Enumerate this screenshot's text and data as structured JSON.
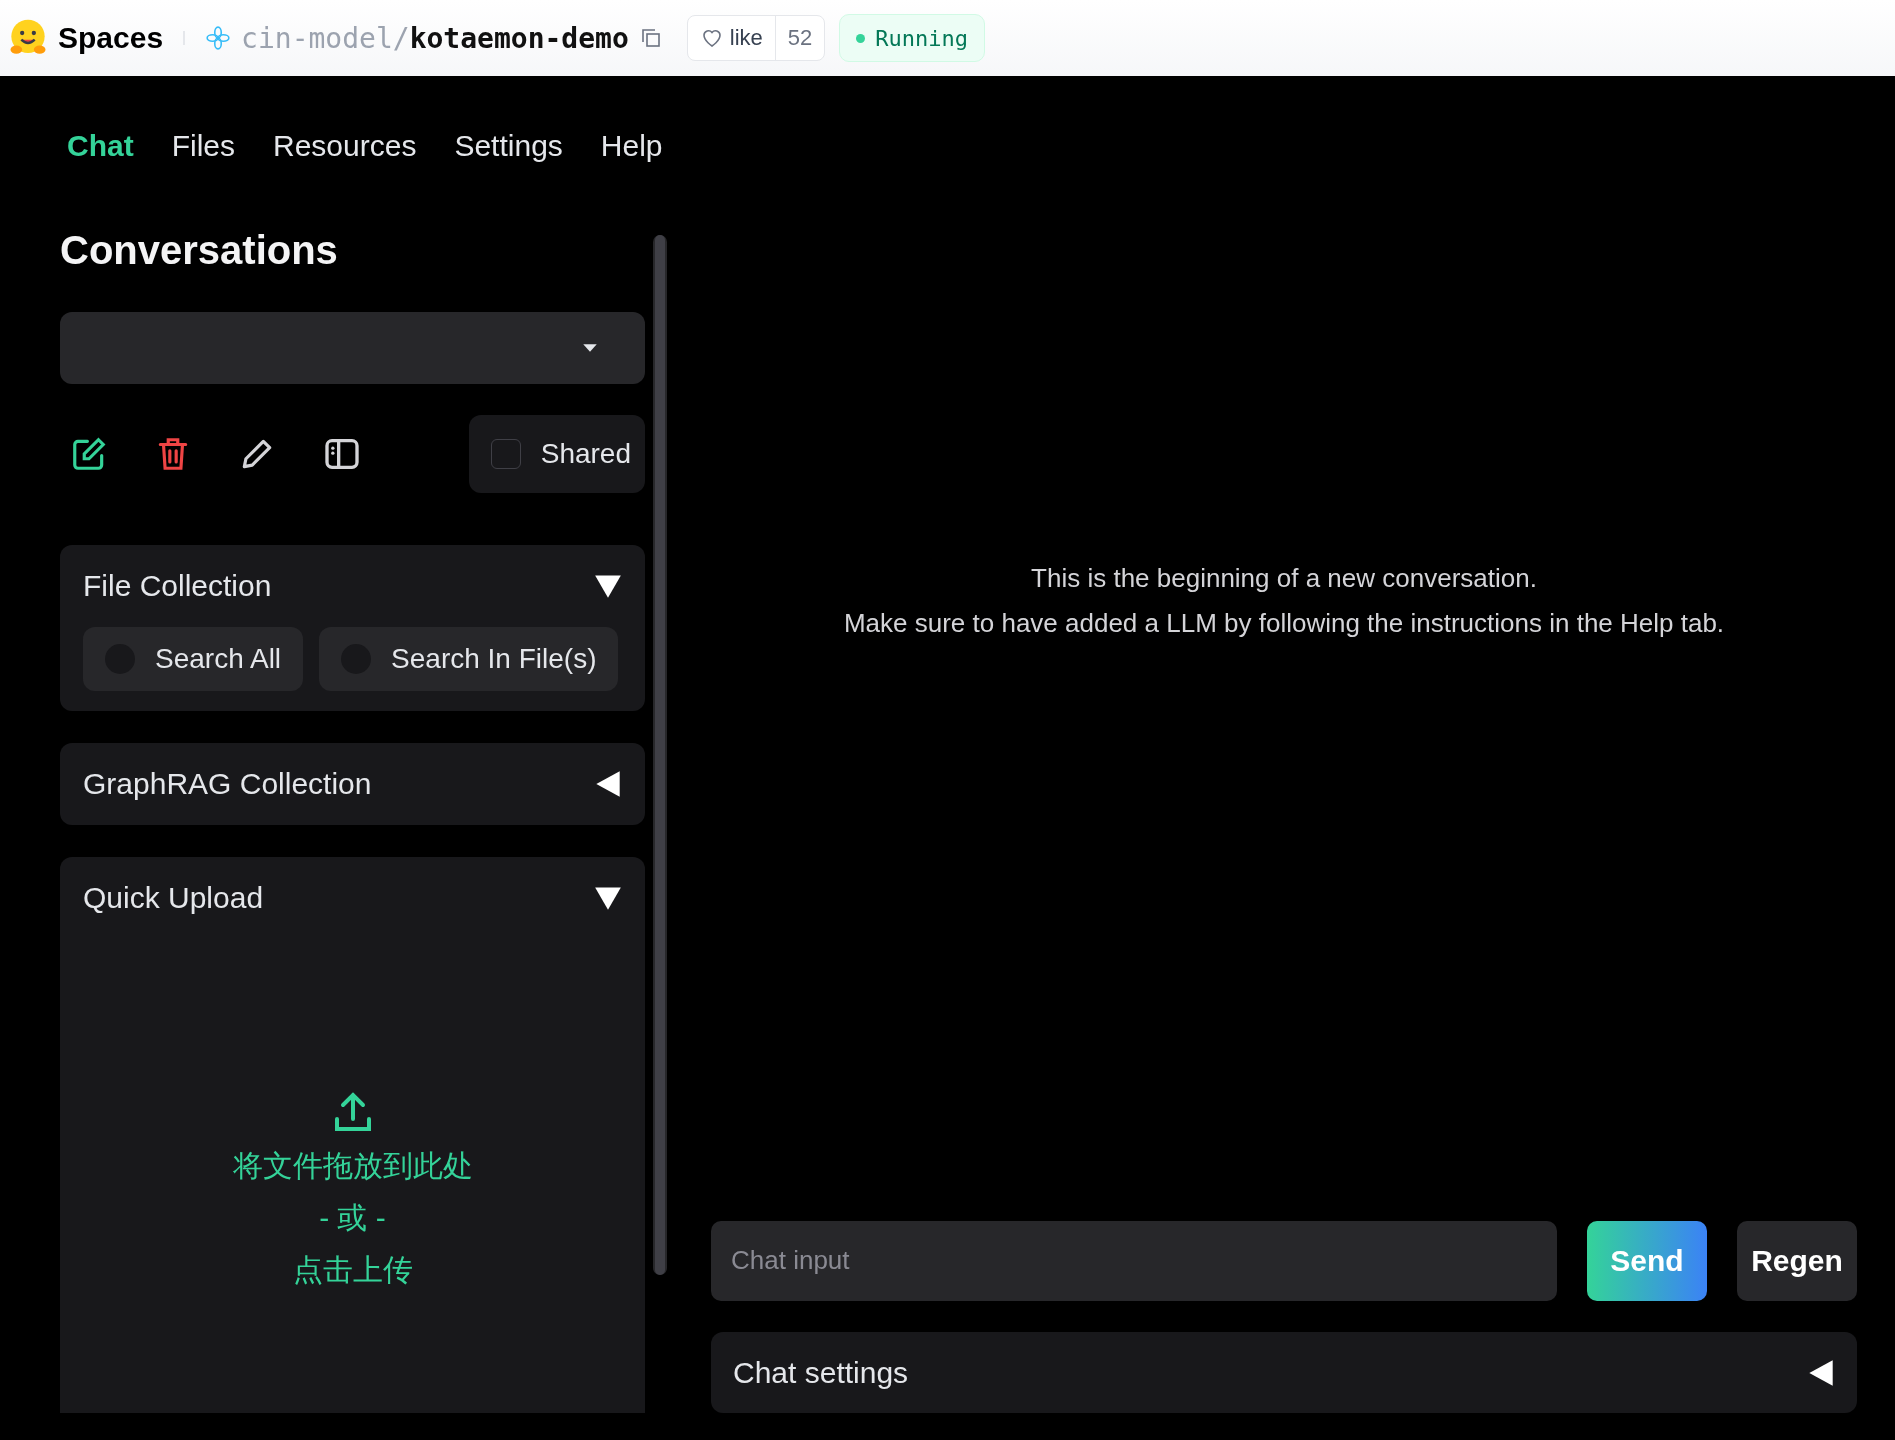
{
  "header": {
    "brand": "Spaces",
    "owner": "cin-model",
    "separator": "/",
    "repo": "kotaemon-demo",
    "like_label": "like",
    "like_count": "52",
    "status": "Running"
  },
  "tabs": [
    {
      "label": "Chat",
      "selected": true
    },
    {
      "label": "Files",
      "selected": false
    },
    {
      "label": "Resources",
      "selected": false
    },
    {
      "label": "Settings",
      "selected": false
    },
    {
      "label": "Help",
      "selected": false
    }
  ],
  "sidebar": {
    "title": "Conversations",
    "shared": {
      "label": "Shared",
      "checked": false
    },
    "panels": [
      {
        "kind": "radios",
        "title": "File Collection",
        "expanded": true,
        "options": [
          {
            "label": "Search All",
            "selected": false
          },
          {
            "label": "Search In File(s)",
            "selected": false
          }
        ]
      },
      {
        "title": "GraphRAG Collection",
        "expanded": false
      },
      {
        "kind": "upload",
        "title": "Quick Upload",
        "expanded": true,
        "drop_text": "将文件拖放到此处",
        "or_text": "- 或 -",
        "click_text": "点击上传"
      }
    ]
  },
  "chat": {
    "messages": [
      "This is the beginning of a new conversation.",
      "Make sure to have added a LLM by following the instructions in the Help tab."
    ],
    "input": {
      "placeholder": "Chat input"
    },
    "buttons": [
      {
        "kind": "primary",
        "label": "Send"
      },
      {
        "kind": "secondary",
        "label": "Regen"
      }
    ],
    "settings": {
      "title": "Chat settings",
      "expanded": false
    }
  }
}
